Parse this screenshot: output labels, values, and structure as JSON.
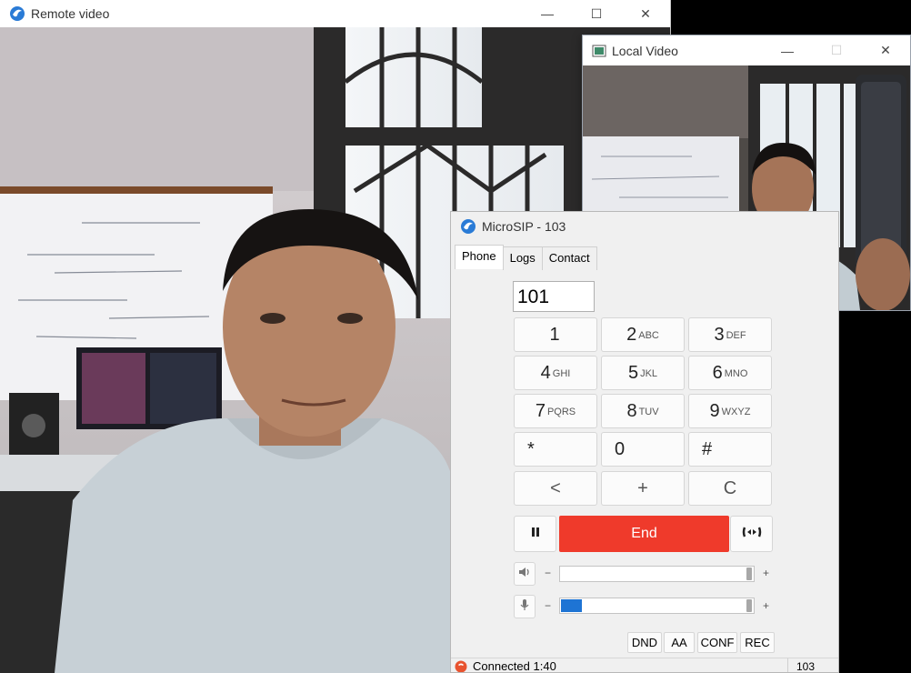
{
  "remote_window": {
    "title": "Remote video",
    "controls": {
      "minimize": "—",
      "maximize": "☐",
      "close": "✕"
    },
    "icon": "microsip-globe-icon"
  },
  "local_window": {
    "title": "Local Video",
    "controls": {
      "minimize": "—",
      "maximize": "☐",
      "close": "✕"
    },
    "icon": "video-window-icon"
  },
  "microsip": {
    "title": "MicroSIP - 103",
    "controls": {
      "minimize": "—"
    },
    "tabs": [
      {
        "label": "Phone"
      },
      {
        "label": "Logs"
      },
      {
        "label": "Contact"
      }
    ],
    "dial_value": "101",
    "keypad": [
      {
        "digit": "1",
        "letters": ""
      },
      {
        "digit": "2",
        "letters": "ABC"
      },
      {
        "digit": "3",
        "letters": "DEF"
      },
      {
        "digit": "4",
        "letters": "GHI"
      },
      {
        "digit": "5",
        "letters": "JKL"
      },
      {
        "digit": "6",
        "letters": "MNO"
      },
      {
        "digit": "7",
        "letters": "PQRS"
      },
      {
        "digit": "8",
        "letters": "TUV"
      },
      {
        "digit": "9",
        "letters": "WXYZ"
      },
      {
        "digit": "*",
        "letters": ""
      },
      {
        "digit": "0",
        "letters": ""
      },
      {
        "digit": "#",
        "letters": ""
      }
    ],
    "edit_keys": {
      "back": "<",
      "plus": "+",
      "clear": "C"
    },
    "end_label": "End",
    "speaker": {
      "minus": "−",
      "plus": "+",
      "level": 0.95
    },
    "mic": {
      "minus": "−",
      "plus": "+",
      "level": 0.11
    },
    "options": {
      "dnd": "DND",
      "aa": "AA",
      "conf": "CONF",
      "rec": "REC"
    },
    "status": {
      "text": "Connected 1:40",
      "extension": "103"
    },
    "colors": {
      "end_button": "#ef3a2b",
      "mic_level": "#1e74d4",
      "status_dot": "#e8532f"
    }
  }
}
